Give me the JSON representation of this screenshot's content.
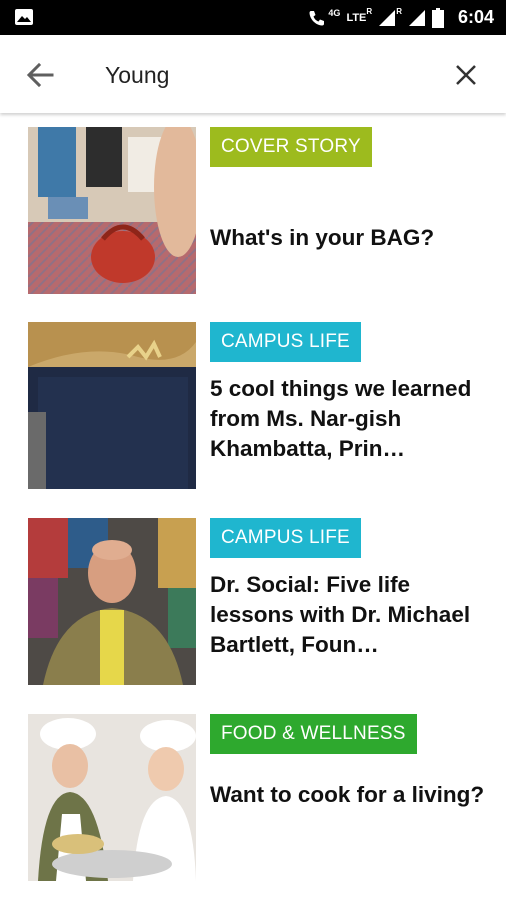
{
  "status_bar": {
    "time": "6:04",
    "network": "LTE",
    "network_sub": "4G",
    "roaming": "R",
    "icons": [
      "image-notification-icon",
      "wifi-calling-icon",
      "signal-icon",
      "signal-icon",
      "battery-icon"
    ]
  },
  "search": {
    "query": "Young",
    "back_icon": "arrow-back-icon",
    "clear_icon": "close-icon"
  },
  "colors": {
    "cover_story": "#9dbb1e",
    "campus_life": "#1fb6cf",
    "food_wellness": "#2ea92e"
  },
  "results": [
    {
      "tag": "COVER STORY",
      "title": "What's in your BAG?"
    },
    {
      "tag": "CAMPUS LIFE",
      "title": "5 cool things we learned from Ms. Nar-gish Khambatta, Prin…"
    },
    {
      "tag": "CAMPUS LIFE",
      "title": "Dr. Social: Five life lessons with Dr. Michael Bartlett, Foun…"
    },
    {
      "tag": "FOOD & WELLNESS",
      "title": "Want to cook for a living?"
    }
  ]
}
